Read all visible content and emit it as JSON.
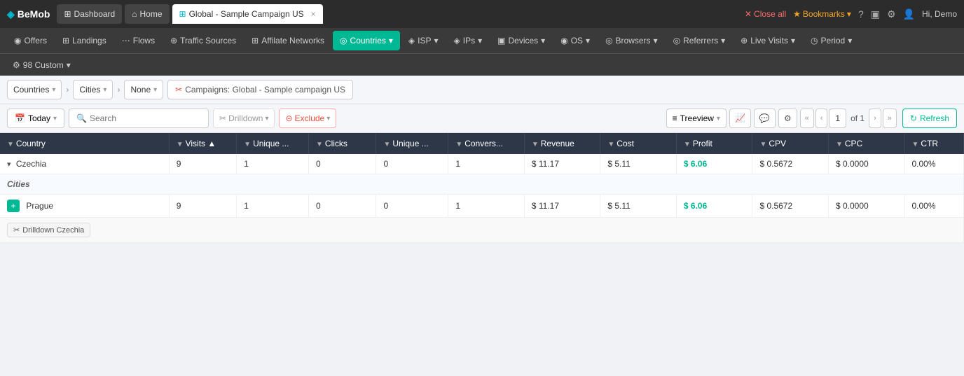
{
  "brand": {
    "icon": "◈",
    "name": "BeMob"
  },
  "topnav": {
    "dashboard_label": "Dashboard",
    "home_label": "Home",
    "tab_label": "Global - Sample Campaign US",
    "close_tab_icon": "×",
    "close_all_label": "Close all",
    "bookmarks_label": "Bookmarks",
    "help_icon": "?",
    "hi_label": "Hi, Demo"
  },
  "secondnav": {
    "items": [
      {
        "id": "offers",
        "label": "Offers",
        "icon": "◉",
        "active": false
      },
      {
        "id": "landings",
        "label": "Landings",
        "icon": "⊞",
        "active": false
      },
      {
        "id": "flows",
        "label": "Flows",
        "icon": "⋯",
        "active": false
      },
      {
        "id": "traffic-sources",
        "label": "Traffic Sources",
        "icon": "⊕",
        "active": false
      },
      {
        "id": "affiliate-networks",
        "label": "Affilate Networks",
        "icon": "⊞",
        "active": false
      },
      {
        "id": "countries",
        "label": "Countries",
        "icon": "◎",
        "active": true
      },
      {
        "id": "isp",
        "label": "ISP",
        "icon": "◈",
        "active": false
      },
      {
        "id": "ips",
        "label": "IPs",
        "icon": "◈",
        "active": false
      },
      {
        "id": "devices",
        "label": "Devices",
        "icon": "▣",
        "active": false
      },
      {
        "id": "os",
        "label": "OS",
        "icon": "◉",
        "active": false
      },
      {
        "id": "browsers",
        "label": "Browsers",
        "icon": "◎",
        "active": false
      },
      {
        "id": "referrers",
        "label": "Referrers",
        "icon": "◎",
        "active": false
      },
      {
        "id": "live-visits",
        "label": "Live Visits",
        "icon": "⊕",
        "active": false
      },
      {
        "id": "period",
        "label": "Period",
        "icon": "◷",
        "active": false
      }
    ]
  },
  "thirdnav": {
    "custom_label": "98 Custom",
    "custom_icon": "⚙"
  },
  "toolbar": {
    "dimension1": "Countries",
    "dimension2": "Cities",
    "dimension3": "None",
    "campaign_icon": "✂",
    "campaign_label": "Campaigns: Global - Sample campaign US"
  },
  "filterbar": {
    "date_icon": "📅",
    "date_label": "Today",
    "search_placeholder": "Search",
    "drilldown_icon": "✂",
    "drilldown_label": "Drilldown",
    "exclude_icon": "⊝",
    "exclude_label": "Exclude",
    "treeview_icon": "≡",
    "treeview_label": "Treeview",
    "chart_icon": "📈",
    "comment_icon": "💬",
    "settings_icon": "⚙",
    "page_first_icon": "«",
    "page_prev_icon": "‹",
    "page_current": "1",
    "page_of": "of 1",
    "page_next_icon": "›",
    "page_last_icon": "»",
    "refresh_icon": "↻",
    "refresh_label": "Refresh"
  },
  "table": {
    "columns": [
      {
        "id": "country",
        "label": "Country"
      },
      {
        "id": "visits",
        "label": "Visits"
      },
      {
        "id": "unique",
        "label": "Unique..."
      },
      {
        "id": "clicks",
        "label": "Clicks"
      },
      {
        "id": "unique2",
        "label": "Unique ..."
      },
      {
        "id": "conversions",
        "label": "Convers..."
      },
      {
        "id": "revenue",
        "label": "Revenue"
      },
      {
        "id": "cost",
        "label": "Cost"
      },
      {
        "id": "profit",
        "label": "Profit"
      },
      {
        "id": "cpv",
        "label": "CPV"
      },
      {
        "id": "cpc",
        "label": "CPC"
      },
      {
        "id": "ctr",
        "label": "CTR"
      }
    ],
    "rows": [
      {
        "type": "country",
        "expanded": true,
        "name": "Czechia",
        "visits": "9",
        "unique": "1",
        "clicks": "0",
        "unique2": "0",
        "conversions": "1",
        "revenue": "$ 11.17",
        "cost": "$ 5.11",
        "profit": "$ 6.06",
        "profit_color": "green",
        "cpv": "$ 0.5672",
        "cpc": "$ 0.0000",
        "ctr": "0.00%"
      },
      {
        "type": "cities-header",
        "label": "Cities"
      },
      {
        "type": "city",
        "name": "Prague",
        "visits": "9",
        "unique": "1",
        "clicks": "0",
        "unique2": "0",
        "conversions": "1",
        "revenue": "$ 11.17",
        "cost": "$ 5.11",
        "profit": "$ 6.06",
        "profit_color": "green",
        "cpv": "$ 0.5672",
        "cpc": "$ 0.0000",
        "ctr": "0.00%"
      }
    ],
    "drilldown_label": "Drilldown Czechia",
    "drilldown_icon": "✂"
  }
}
